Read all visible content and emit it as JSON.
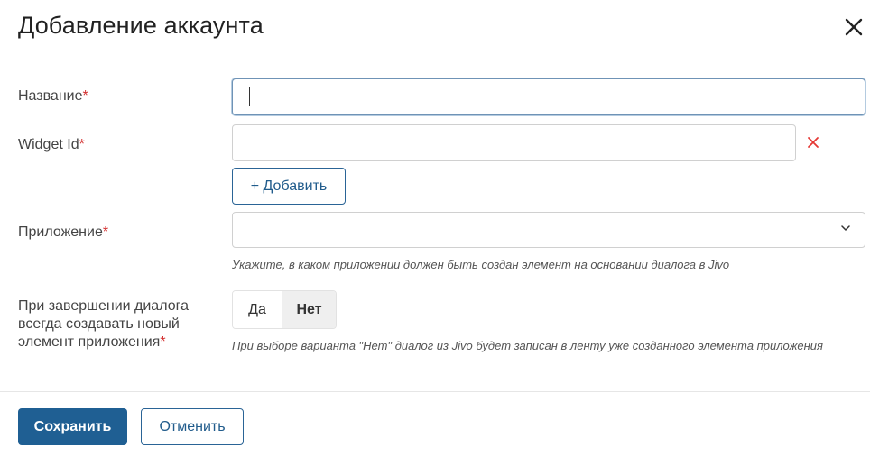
{
  "dialog": {
    "title": "Добавление аккаунта"
  },
  "form": {
    "name": {
      "label": "Название",
      "required_mark": "*",
      "value": ""
    },
    "widget_id": {
      "label": "Widget Id",
      "required_mark": "*",
      "value": ""
    },
    "add_button": {
      "label": "+ Добавить"
    },
    "application": {
      "label": "Приложение",
      "required_mark": "*",
      "selected": "",
      "hint": "Укажите, в каком приложении должен быть создан элемент на основании диалога в Jivo"
    },
    "create_new": {
      "label_lines": [
        "При завершении диалога",
        "всегда создавать новый",
        "элемент приложения"
      ],
      "required_mark": "*",
      "options": [
        "Да",
        "Нет"
      ],
      "selected": "Нет",
      "hint": "При выборе варианта \"Нет\" диалог из Jivo будет записан в ленту уже созданного элемента приложения"
    }
  },
  "footer": {
    "save_label": "Сохранить",
    "cancel_label": "Отменить"
  },
  "colors": {
    "primary": "#1f5f93",
    "required": "#d32f2f",
    "remove_icon": "#e53935",
    "focus_border": "#6f93b6"
  }
}
